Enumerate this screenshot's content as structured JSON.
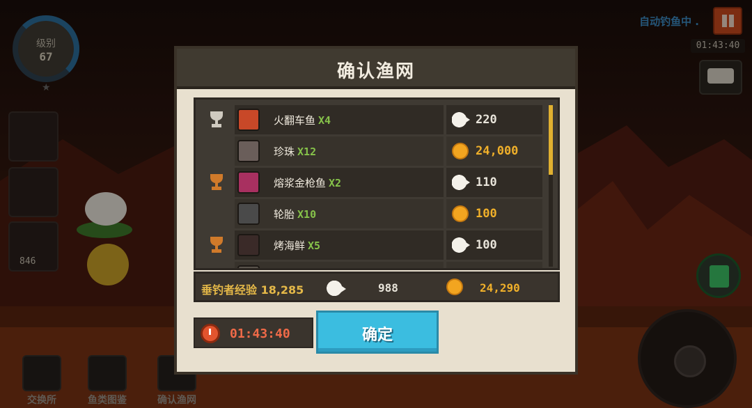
{
  "hud": {
    "level_label": "级别",
    "level_value": "67",
    "bait_count": "846",
    "auto_status": "自动钓鱼中 .",
    "top_timer": "01:43:40"
  },
  "bottom_nav": [
    {
      "label": "交换所"
    },
    {
      "label": "鱼类图鉴"
    },
    {
      "label": "确认渔网"
    }
  ],
  "dialog": {
    "title": "确认渔网",
    "rows": [
      {
        "trophy": "silver-trophy",
        "name": "火翻车鱼",
        "qty": "X4",
        "currency": "fish",
        "value": "220"
      },
      {
        "trophy": "",
        "name": "珍珠",
        "qty": "X12",
        "currency": "coin",
        "value": "24,000"
      },
      {
        "trophy": "bronze-trophy",
        "name": "熔浆金枪鱼",
        "qty": "X2",
        "currency": "fish",
        "value": "110"
      },
      {
        "trophy": "",
        "name": "轮胎",
        "qty": "X10",
        "currency": "coin",
        "value": "100"
      },
      {
        "trophy": "bronze-trophy",
        "name": "烤海鲜",
        "qty": "X5",
        "currency": "fish",
        "value": "100"
      }
    ],
    "summary": {
      "exp_label": "垂钓者经验 18,285",
      "fish_total": "988",
      "coin_total": "24,290"
    },
    "timer": "01:43:40",
    "confirm_label": "确定"
  },
  "colors": {
    "confirm": "#3bbde0",
    "gold": "#f0b02a",
    "qty_green": "#86c24a",
    "timer_red": "#f06a48"
  }
}
